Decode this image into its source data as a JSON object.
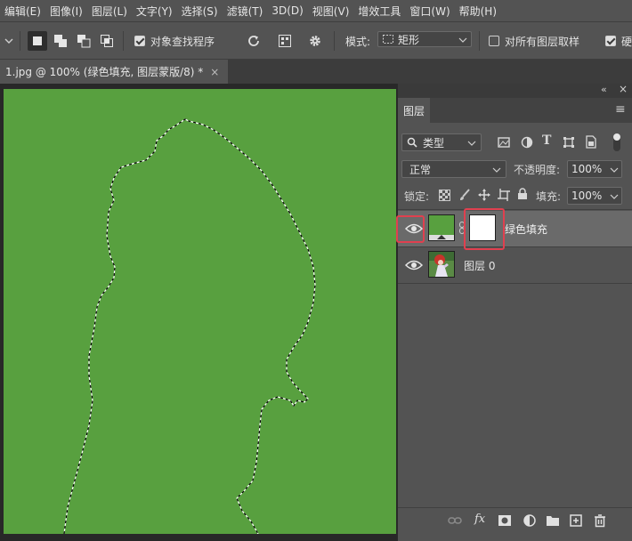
{
  "menu": [
    "编辑(E)",
    "图像(I)",
    "图层(L)",
    "文字(Y)",
    "选择(S)",
    "滤镜(T)",
    "3D(D)",
    "视图(V)",
    "增效工具",
    "窗口(W)",
    "帮助(H)"
  ],
  "options": {
    "object_finder_label": "对象查找程序",
    "mode_label": "模式:",
    "mode_value": "矩形",
    "sample_all_label": "对所有图层取样",
    "trailing_label": "硬"
  },
  "document_tab": {
    "title": "1.jpg @ 100% (绿色填充, 图层蒙版/8) *",
    "close": "×"
  },
  "panel": {
    "collapse_glyph": "«",
    "close_glyph": "×",
    "tab_label": "图层",
    "menu_glyph": "≡",
    "filter_kind": "类型",
    "blend_mode": "正常",
    "opacity_label": "不透明度:",
    "opacity_value": "100%",
    "lock_label": "锁定:",
    "fill_label": "填充:",
    "fill_value": "100%",
    "layers": [
      {
        "name": "绿色填充",
        "selected": true,
        "visible": true
      },
      {
        "name": "图层 0",
        "selected": false,
        "visible": true
      }
    ]
  },
  "colors": {
    "canvas_green": "#58a03f",
    "highlight_red": "#e0404f",
    "panel_bg": "#535353"
  }
}
